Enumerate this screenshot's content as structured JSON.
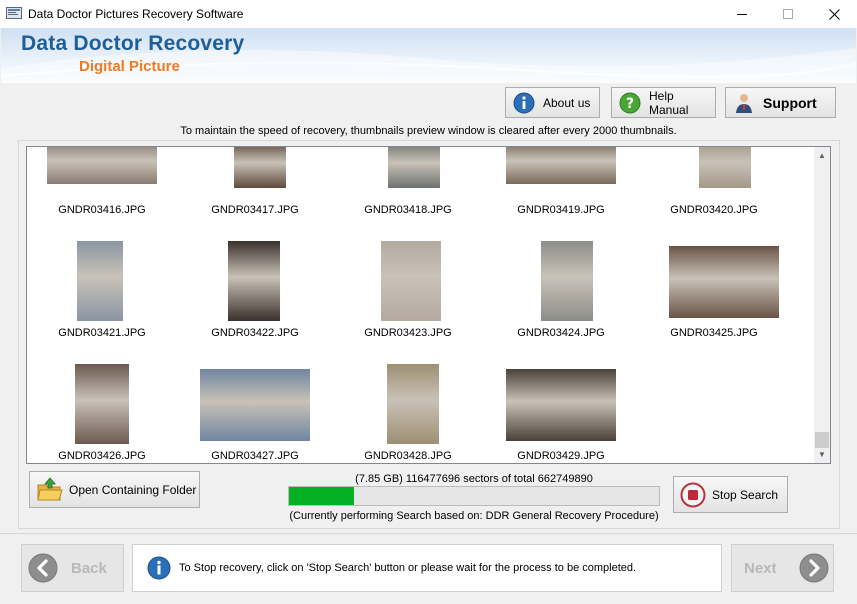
{
  "window": {
    "title": "Data Doctor Pictures Recovery Software"
  },
  "banner": {
    "brand": "Data Doctor Recovery",
    "subbrand": "Digital Picture"
  },
  "header_buttons": {
    "about": "About us",
    "help": "Help Manual",
    "support": "Support"
  },
  "notice": "To maintain the speed of recovery, thumbnails preview window is cleared after every 2000 thumbnails.",
  "thumbnails": [
    {
      "name": "GNDR03416.JPG",
      "color": "#8a7c72"
    },
    {
      "name": "GNDR03417.JPG",
      "color": "#5e4a3c"
    },
    {
      "name": "GNDR03418.JPG",
      "color": "#6d7270"
    },
    {
      "name": "GNDR03419.JPG",
      "color": "#7a6a5a"
    },
    {
      "name": "GNDR03420.JPG",
      "color": "#a39888"
    },
    {
      "name": "GNDR03421.JPG",
      "color": "#8a96a2"
    },
    {
      "name": "GNDR03422.JPG",
      "color": "#3a302c"
    },
    {
      "name": "GNDR03423.JPG",
      "color": "#b4aa9f"
    },
    {
      "name": "GNDR03424.JPG",
      "color": "#8c8c88"
    },
    {
      "name": "GNDR03425.JPG",
      "color": "#6a5346"
    },
    {
      "name": "GNDR03426.JPG",
      "color": "#6c5a50"
    },
    {
      "name": "GNDR03427.JPG",
      "color": "#6f86a0"
    },
    {
      "name": "GNDR03428.JPG",
      "color": "#9e8f72"
    },
    {
      "name": "GNDR03429.JPG",
      "color": "#4a4038"
    }
  ],
  "actions": {
    "open_folder": "Open Containing Folder",
    "stop_search": "Stop Search"
  },
  "progress": {
    "sectors_text": "(7.85 GB) 116477696  sectors  of  total 662749890",
    "fraction": 0.1757,
    "method_text": "(Currently performing Search based on:  DDR General Recovery Procedure)"
  },
  "footer": {
    "back": "Back",
    "next": "Next",
    "info": "To Stop recovery, click on 'Stop Search' button or please wait for the process to be completed."
  },
  "colors": {
    "brand": "#1f5f95",
    "subbrand": "#f07a22",
    "progress_fill": "#06b025",
    "stop_red": "#c0283a"
  },
  "icons": {
    "app": "app-icon",
    "about": "info-icon",
    "help": "help-question-icon",
    "support": "support-person-icon",
    "folder": "folder-open-icon",
    "stop": "stop-icon",
    "back": "arrow-left-icon",
    "next": "arrow-right-icon",
    "info": "info-icon"
  }
}
